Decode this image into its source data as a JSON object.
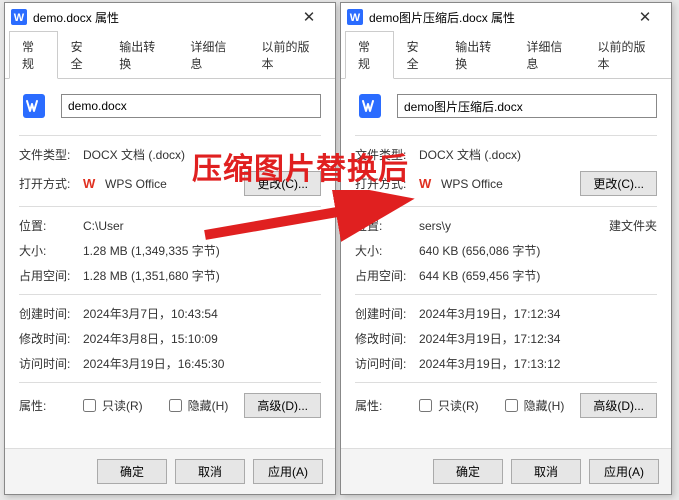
{
  "left": {
    "title": "demo.docx 属性",
    "filename": "demo.docx",
    "filetype": "DOCX 文档 (.docx)",
    "openwith": "WPS Office",
    "location": "C:\\User",
    "size": "1.28 MB (1,349,335 字节)",
    "sizeondisk": "1.28 MB (1,351,680 字节)",
    "created": "2024年3月7日，10:43:54",
    "modified": "2024年3月8日，15:10:09",
    "accessed": "2024年3月19日，16:45:30"
  },
  "right": {
    "title": "demo图片压缩后.docx 属性",
    "filename": "demo图片压缩后.docx",
    "filetype": "DOCX 文档 (.docx)",
    "openwith": "WPS Office",
    "location_prefix": "sers\\y",
    "location_suffix": "建文件夹",
    "size": "640 KB (656,086 字节)",
    "sizeondisk": "644 KB (659,456 字节)",
    "created": "2024年3月19日，17:12:34",
    "modified": "2024年3月19日，17:12:34",
    "accessed": "2024年3月19日，17:13:12"
  },
  "labels": {
    "filetype": "文件类型:",
    "openwith": "打开方式:",
    "location": "位置:",
    "size": "大小:",
    "sizeondisk": "占用空间:",
    "created": "创建时间:",
    "modified": "修改时间:",
    "accessed": "访问时间:",
    "attributes": "属性:",
    "readonly": "只读(R)",
    "hidden": "隐藏(H)",
    "change": "更改(C)...",
    "advanced": "高级(D)...",
    "ok": "确定",
    "cancel": "取消",
    "apply": "应用(A)"
  },
  "tabs": {
    "general": "常规",
    "security": "安全",
    "output": "输出转换",
    "detail": "详细信息",
    "previous": "以前的版本"
  },
  "overlay": "压缩图片替换后"
}
